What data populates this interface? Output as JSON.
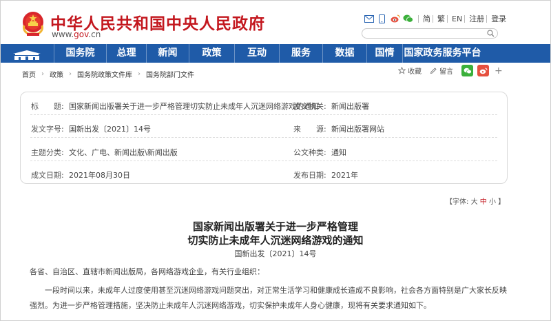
{
  "header": {
    "site_title": "中华人民共和国中央人民政府",
    "url_prefix": "www.",
    "url_gov": "gov",
    "url_suffix": ".cn",
    "links": [
      "简",
      "繁",
      "EN",
      "注册",
      "登录"
    ]
  },
  "nav": {
    "items": [
      "国务院",
      "总理",
      "新闻",
      "政策",
      "互动",
      "服务",
      "数据",
      "国情",
      "国家政务服务平台"
    ]
  },
  "breadcrumb": [
    "首页",
    "政策",
    "国务院政策文件库",
    "国务院部门文件"
  ],
  "tools": {
    "collect": "收藏",
    "comment": "留言",
    "more": "+"
  },
  "info": {
    "title_label": "标　　题:",
    "title_value": "国家新闻出版署关于进一步严格管理切实防止未成年人沉迷网络游戏的通知",
    "issuer_label": "发文机关:",
    "issuer_value": "新闻出版署",
    "docno_label": "发文字号:",
    "docno_value": "国新出发〔2021〕14号",
    "source_label": "来　　源:",
    "source_value": "新闻出版署网站",
    "topic_label": "主题分类:",
    "topic_value": "文化、广电、新闻出版\\新闻出版",
    "doctype_label": "公文种类:",
    "doctype_value": "通知",
    "date_label": "成文日期:",
    "date_value": "2021年08月30日",
    "pubdate_label": "发布日期:",
    "pubdate_value": "2021年"
  },
  "fontsize": {
    "prefix": "【字体:",
    "large": "大",
    "medium": "中",
    "small": "小",
    "suffix": "】"
  },
  "article": {
    "title_line1": "国家新闻出版署关于进一步严格管理",
    "title_line2": "切实防止未成年人沉迷网络游戏的通知",
    "doc_number": "国新出发〔2021〕14号",
    "salutation": "各省、自治区、直辖市新闻出版局，各网络游戏企业，有关行业组织：",
    "paragraph1": "一段时间以来，未成年人过度使用甚至沉迷网络游戏问题突出，对正常生活学习和健康成长造成不良影响，社会各方面特别是广大家长反映强烈。为进一步严格管理措施，坚决防止未成年人沉迷网络游戏，切实保护未成年人身心健康，现将有关要求通知如下。"
  },
  "colors": {
    "brand_red": "#c3171e",
    "nav_blue": "#1f5ba8"
  }
}
